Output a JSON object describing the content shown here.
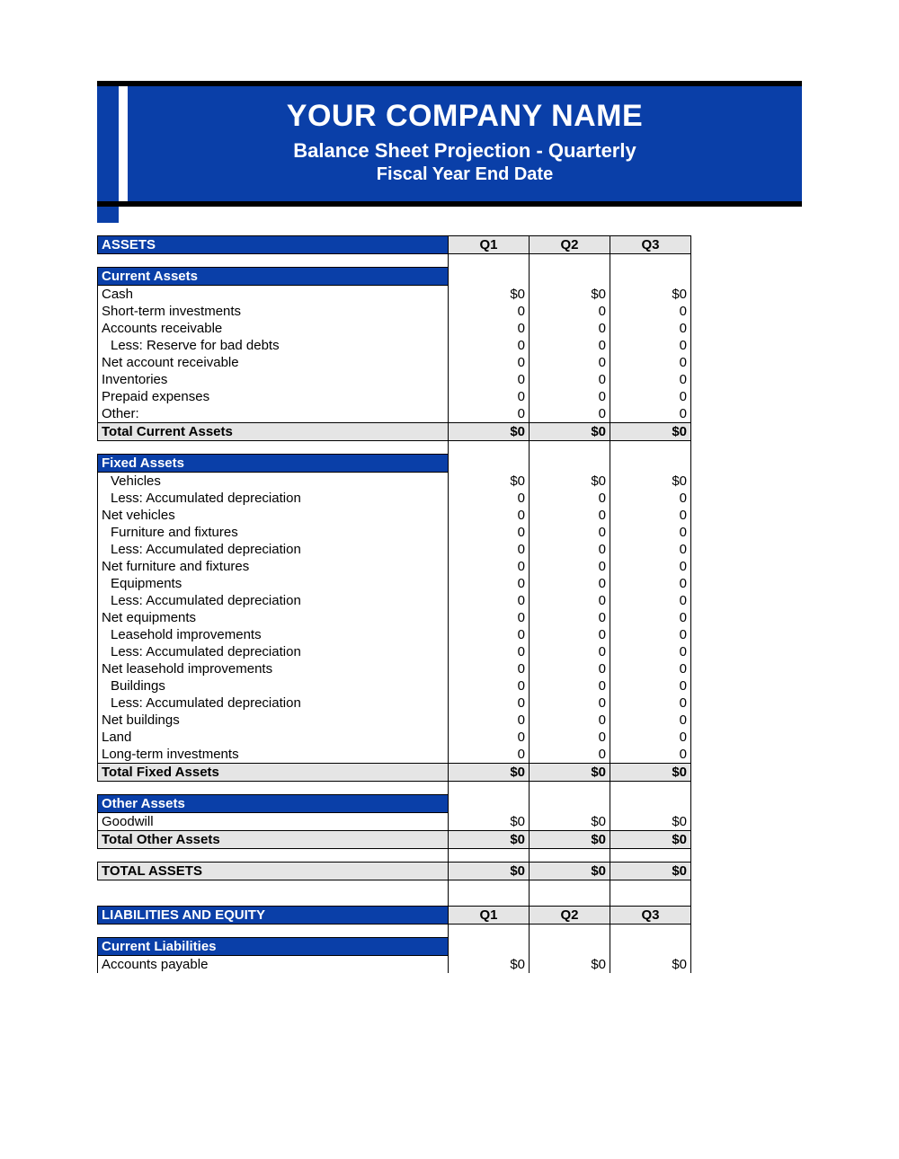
{
  "header": {
    "company": "YOUR COMPANY NAME",
    "subtitle1": "Balance Sheet Projection - Quarterly",
    "subtitle2": "Fiscal Year End Date"
  },
  "quarters": [
    "Q1",
    "Q2",
    "Q3"
  ],
  "sections": [
    {
      "heading": "ASSETS",
      "groups": [
        {
          "heading": "Current Assets",
          "rows": [
            {
              "label": "Cash",
              "vals": [
                "$0",
                "$0",
                "$0"
              ]
            },
            {
              "label": "Short-term investments",
              "vals": [
                "0",
                "0",
                "0"
              ]
            },
            {
              "label": "Accounts receivable",
              "vals": [
                "0",
                "0",
                "0"
              ]
            },
            {
              "label": "Less: Reserve for bad debts",
              "indent": 1,
              "vals": [
                "0",
                "0",
                "0"
              ]
            },
            {
              "label": "Net account receivable",
              "vals": [
                "0",
                "0",
                "0"
              ]
            },
            {
              "label": "Inventories",
              "vals": [
                "0",
                "0",
                "0"
              ]
            },
            {
              "label": "Prepaid expenses",
              "vals": [
                "0",
                "0",
                "0"
              ]
            },
            {
              "label": "Other:",
              "vals": [
                "0",
                "0",
                "0"
              ]
            }
          ],
          "total": {
            "label": "Total Current Assets",
            "vals": [
              "$0",
              "$0",
              "$0"
            ]
          }
        },
        {
          "heading": "Fixed Assets",
          "rows": [
            {
              "label": "Vehicles",
              "indent": 1,
              "vals": [
                "$0",
                "$0",
                "$0"
              ]
            },
            {
              "label": "Less: Accumulated depreciation",
              "indent": 1,
              "vals": [
                "0",
                "0",
                "0"
              ]
            },
            {
              "label": "Net vehicles",
              "vals": [
                "0",
                "0",
                "0"
              ]
            },
            {
              "label": "Furniture and fixtures",
              "indent": 1,
              "vals": [
                "0",
                "0",
                "0"
              ]
            },
            {
              "label": "Less: Accumulated depreciation",
              "indent": 1,
              "vals": [
                "0",
                "0",
                "0"
              ]
            },
            {
              "label": "Net furniture and fixtures",
              "vals": [
                "0",
                "0",
                "0"
              ]
            },
            {
              "label": "Equipments",
              "indent": 1,
              "vals": [
                "0",
                "0",
                "0"
              ]
            },
            {
              "label": "Less: Accumulated depreciation",
              "indent": 1,
              "vals": [
                "0",
                "0",
                "0"
              ]
            },
            {
              "label": "Net equipments",
              "vals": [
                "0",
                "0",
                "0"
              ]
            },
            {
              "label": "Leasehold improvements",
              "indent": 1,
              "vals": [
                "0",
                "0",
                "0"
              ]
            },
            {
              "label": "Less: Accumulated depreciation",
              "indent": 1,
              "vals": [
                "0",
                "0",
                "0"
              ]
            },
            {
              "label": "Net leasehold improvements",
              "vals": [
                "0",
                "0",
                "0"
              ]
            },
            {
              "label": "Buildings",
              "indent": 1,
              "vals": [
                "0",
                "0",
                "0"
              ]
            },
            {
              "label": "Less: Accumulated depreciation",
              "indent": 1,
              "vals": [
                "0",
                "0",
                "0"
              ]
            },
            {
              "label": "Net buildings",
              "vals": [
                "0",
                "0",
                "0"
              ]
            },
            {
              "label": "Land",
              "vals": [
                "0",
                "0",
                "0"
              ]
            },
            {
              "label": "Long-term investments",
              "vals": [
                "0",
                "0",
                "0"
              ]
            }
          ],
          "total": {
            "label": "Total Fixed Assets",
            "vals": [
              "$0",
              "$0",
              "$0"
            ]
          }
        },
        {
          "heading": "Other Assets",
          "rows": [
            {
              "label": "Goodwill",
              "vals": [
                "$0",
                "$0",
                "$0"
              ]
            }
          ],
          "total": {
            "label": "Total Other Assets",
            "vals": [
              "$0",
              "$0",
              "$0"
            ]
          }
        }
      ],
      "grand_total": {
        "label": "TOTAL ASSETS",
        "vals": [
          "$0",
          "$0",
          "$0"
        ]
      }
    },
    {
      "heading": "LIABILITIES AND EQUITY",
      "groups": [
        {
          "heading": "Current Liabilities",
          "rows": [
            {
              "label": "Accounts payable",
              "vals": [
                "$0",
                "$0",
                "$0"
              ]
            }
          ]
        }
      ]
    }
  ]
}
